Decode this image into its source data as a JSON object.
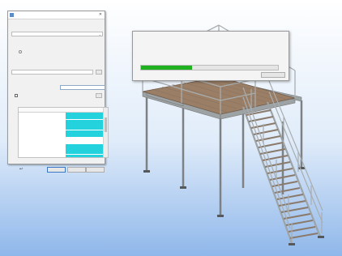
{
  "viewport": {
    "background_top": "#ffffff",
    "background_bottom": "#8fb7ea",
    "deck_color": "#9a7e66",
    "steel_color": "#a9adae",
    "tread_color": "#8a7a6c"
  },
  "panel": {
    "title": "",
    "section1_label": "",
    "section1_value": "",
    "option_label": "",
    "section2_label": "",
    "section2_sub_label": "",
    "section2_value": "",
    "section3_label": "",
    "name_label": "",
    "name_value": "",
    "checkbox_label": "",
    "grid": {
      "col1_header": "",
      "col2_header": "",
      "rows": [
        {
          "label": "",
          "value": "",
          "highlight": true
        },
        {
          "label": "",
          "value": "",
          "highlight": true
        },
        {
          "label": "",
          "value": "",
          "highlight": true
        },
        {
          "label": "",
          "value": "",
          "highlight": true
        },
        {
          "label": "",
          "value": "",
          "highlight": true
        },
        {
          "label": "",
          "value": "",
          "highlight": true
        },
        {
          "label": "",
          "value": "",
          "highlight": true
        },
        {
          "label": "",
          "value": "",
          "highlight": false
        },
        {
          "label": "",
          "value": "",
          "highlight": false
        },
        {
          "label": "",
          "value": "",
          "highlight": true
        },
        {
          "label": "",
          "value": "",
          "highlight": true
        },
        {
          "label": "",
          "value": "",
          "highlight": true
        },
        {
          "label": "",
          "value": "",
          "highlight": true
        }
      ]
    },
    "ok_label": "",
    "cancel_label": "",
    "apply_label": ""
  },
  "progress_dialog": {
    "title": "",
    "status": "",
    "progress_fraction": 0.37,
    "cancel_label": "",
    "bar_color": "#20b120"
  },
  "accent": {
    "highlight_cell": "#23d2dc",
    "progress_green": "#20b120"
  }
}
